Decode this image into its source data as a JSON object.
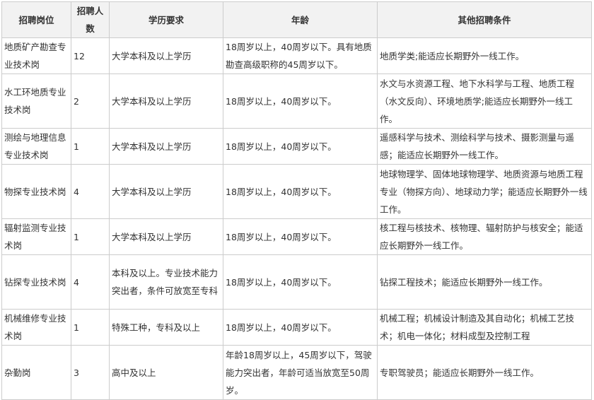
{
  "table": {
    "headers": [
      "招聘岗位",
      "招聘人数",
      "学历要求",
      "年龄",
      "其他招聘条件"
    ],
    "rows": [
      [
        "地质矿产勘查专业技术岗",
        "12",
        "大学本科及以上学历",
        "18周岁以上，40周岁以下。具有地质勘查高级职称的45周岁以下。",
        "地质学类;能适应长期野外一线工作。"
      ],
      [
        "水工环地质专业技术岗",
        "2",
        "大学本科及以上学历",
        "18周岁以上，40周岁以下。",
        "水文与水资源工程、地下水科学与工程、地质工程（水文反向）、环境地质学;能适应长期野外一线工作。"
      ],
      [
        "测绘与地理信息专业技术岗",
        "1",
        "大学本科及以上学历",
        "18周岁以上，40周岁以下。",
        "遥感科学与技术、测绘科学与技术、摄影测量与遥感；能适应长期野外一线工作。"
      ],
      [
        "物探专业技术岗",
        "4",
        "大学本科及以上学历",
        "18周岁以上，40周岁以下。",
        "地球物理学、固体地球物理学、地质资源与地质工程专业（物探方向）、地球动力学；能适应长期野外一线工作。"
      ],
      [
        "辐射监测专业技术岗",
        "1",
        "大学本科及以上学历",
        "18周岁以上，40周岁以下。",
        "核工程与核技术、核物理、辐射防护与核安全；能适应长期野外一线工作。"
      ],
      [
        "钻探专业技术岗",
        "4",
        "本科及以上。专业技术能力突出者，条件可放宽至专科",
        "18周岁以上，40周岁以下。",
        "钻探工程技术；能适应长期野外一线工作。"
      ],
      [
        "机械维修专业技术岗",
        "1",
        "特殊工种，专科及以上",
        "18周岁以上，40周岁以下。",
        "机械工程；机械设计制造及其自动化；机械工艺技术；机电一体化；材料成型及控制工程"
      ],
      [
        "杂勤岗",
        "3",
        "高中及以上",
        "年龄18周岁以上，45周岁以下，驾驶能力突出者，年龄可适当放宽至50周岁。",
        "专职驾驶员；能适应长期野外一线工作。"
      ]
    ]
  }
}
